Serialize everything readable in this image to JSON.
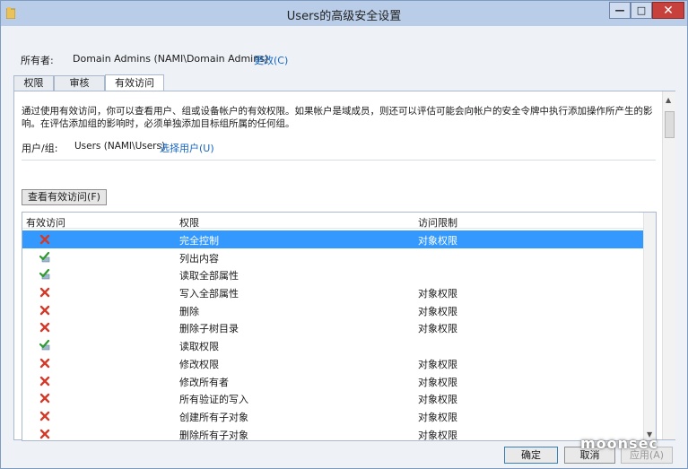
{
  "window": {
    "title": "Users的高级安全设置",
    "minimize_glyph": "—",
    "maximize_glyph": "□",
    "close_glyph": "✕"
  },
  "owner": {
    "label": "所有者:",
    "value": "Domain Admins (NAMI\\Domain Admins)",
    "change_link": "更改(C)"
  },
  "tabs": [
    {
      "label": "权限"
    },
    {
      "label": "审核"
    },
    {
      "label": "有效访问",
      "active": true
    }
  ],
  "panel": {
    "description": "通过使用有效访问，你可以查看用户、组或设备帐户的有效权限。如果帐户是域成员，则还可以评估可能会向帐户的安全令牌中执行添加操作所产生的影响。在评估添加组的影响时，必须单独添加目标组所属的任何组。",
    "user_label": "用户/组:",
    "user_value": "Users (NAMI\\Users)",
    "select_user_link": "选择用户(U)",
    "view_button": "查看有效访问(F)"
  },
  "table": {
    "headers": [
      "有效访问",
      "权限",
      "访问限制"
    ],
    "rows": [
      {
        "icon": "red-x-icon",
        "permission": "完全控制",
        "limit": "对象权限",
        "selected": true
      },
      {
        "icon": "green-check-icon",
        "permission": "列出内容",
        "limit": ""
      },
      {
        "icon": "green-check-icon",
        "permission": "读取全部属性",
        "limit": ""
      },
      {
        "icon": "red-x-icon",
        "permission": "写入全部属性",
        "limit": "对象权限"
      },
      {
        "icon": "red-x-icon",
        "permission": "删除",
        "limit": "对象权限"
      },
      {
        "icon": "red-x-icon",
        "permission": "删除子树目录",
        "limit": "对象权限"
      },
      {
        "icon": "green-check-icon",
        "permission": "读取权限",
        "limit": ""
      },
      {
        "icon": "red-x-icon",
        "permission": "修改权限",
        "limit": "对象权限"
      },
      {
        "icon": "red-x-icon",
        "permission": "修改所有者",
        "limit": "对象权限"
      },
      {
        "icon": "red-x-icon",
        "permission": "所有验证的写入",
        "limit": "对象权限"
      },
      {
        "icon": "red-x-icon",
        "permission": "创建所有子对象",
        "limit": "对象权限"
      },
      {
        "icon": "red-x-icon",
        "permission": "删除所有子对象",
        "limit": "对象权限"
      }
    ]
  },
  "footer": {
    "ok": "确定",
    "cancel": "取消",
    "apply": "应用(A)"
  },
  "watermark": "moonsec",
  "colors": {
    "titlebar": "#b9cde8",
    "selection": "#3399ff",
    "link": "#1565c0",
    "close": "#c7403b"
  }
}
